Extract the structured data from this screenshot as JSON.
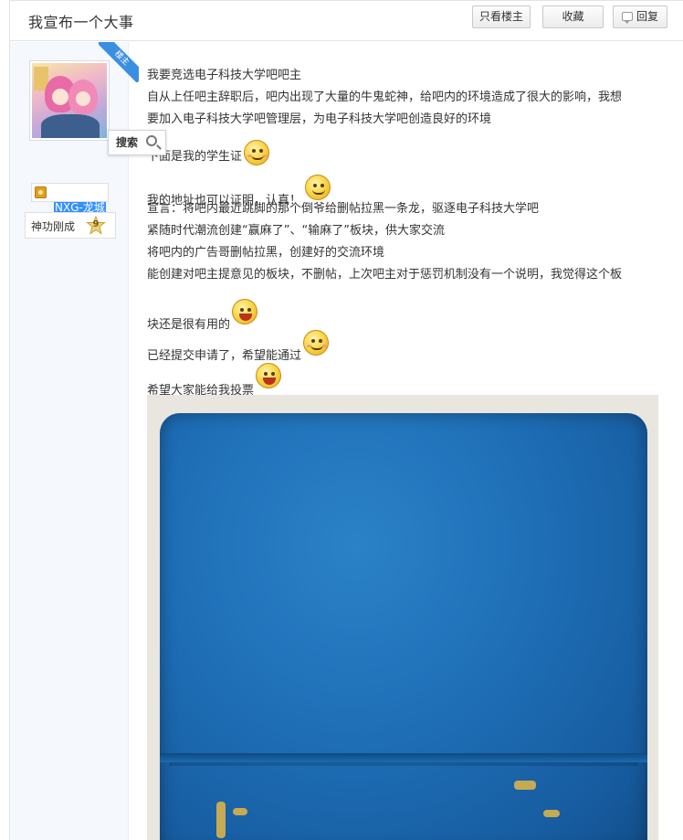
{
  "header": {
    "title": "我宣布一个大事",
    "only_op_label": "只看楼主",
    "favorite_label": "收藏",
    "reply_label": "回复"
  },
  "author": {
    "badge": "楼主",
    "search_tooltip": "搜索",
    "username": "NXG-龙城",
    "rank_title": "神功刚成",
    "rank_level": "9"
  },
  "post": {
    "lines": [
      "我要竞选电子科技大学吧吧主",
      "自从上任吧主辞职后，吧内出现了大量的牛鬼蛇神，给吧内的环境造成了很大的影响，我想",
      "要加入电子科技大学吧管理层，为电子科技大学吧创造良好的环境",
      "下面是我的学生证",
      "我的地址也可以证明，认真！",
      "宣言：将吧内最近跳脚的那个倒爷给删帖拉黑一条龙，驱逐电子科技大学吧",
      "紧随时代潮流创建“赢麻了”、“输麻了”板块，供大家交流",
      "将吧内的广告哥删帖拉黑，创建好的交流环境",
      "能创建对吧主提意见的板块，不删帖，上次吧主对于惩罚机制没有一个说明，我觉得这个板",
      "块还是很有用的",
      "已经提交申请了，希望能通过",
      "希望大家能给我投票"
    ]
  }
}
